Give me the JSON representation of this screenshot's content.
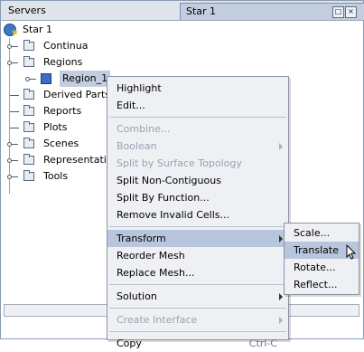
{
  "tabs": {
    "servers": "Servers",
    "star1": "Star 1"
  },
  "tab_buttons": {
    "minimize": "□",
    "close": "×"
  },
  "tree": {
    "root": "Star 1",
    "items": [
      "Continua",
      "Regions",
      "Region_1",
      "Derived Parts",
      "Reports",
      "Plots",
      "Scenes",
      "Representations",
      "Tools"
    ]
  },
  "context_menu": {
    "highlight": "Highlight",
    "edit": "Edit...",
    "combine": "Combine...",
    "boolean": "Boolean",
    "split_surface_topology": "Split by Surface Topology",
    "split_non_contiguous": "Split Non-Contiguous",
    "split_by_function": "Split By Function...",
    "remove_invalid_cells": "Remove Invalid Cells...",
    "transform": "Transform",
    "reorder_mesh": "Reorder Mesh",
    "replace_mesh": "Replace Mesh...",
    "solution": "Solution",
    "create_interface": "Create Interface",
    "copy": "Copy",
    "copy_shortcut": "Ctrl-C"
  },
  "submenu": {
    "scale": "Scale...",
    "translate": "Translate",
    "rotate": "Rotate...",
    "reflect": "Reflect..."
  }
}
